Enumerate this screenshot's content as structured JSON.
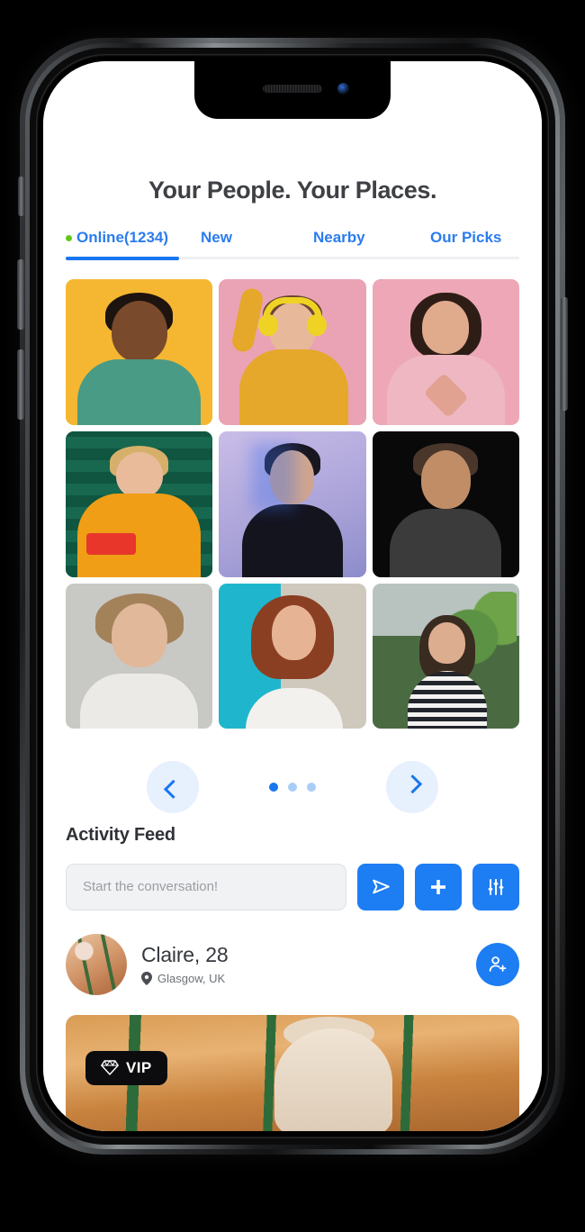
{
  "app": {
    "title": "Your People. Your Places."
  },
  "tabs": [
    {
      "label": "Online(1234)",
      "active": true,
      "has_online_dot": true
    },
    {
      "label": "New",
      "active": false,
      "has_online_dot": false
    },
    {
      "label": "Nearby",
      "active": false,
      "has_online_dot": false
    },
    {
      "label": "Our Picks",
      "active": false,
      "has_online_dot": false
    }
  ],
  "grid": {
    "people": [
      {
        "alt": "man-in-teal-polo-yellow-background"
      },
      {
        "alt": "woman-with-yellow-headphones-pink-background"
      },
      {
        "alt": "woman-making-heart-hands-pink-background"
      },
      {
        "alt": "woman-in-orange-holding-red-phone-green-background"
      },
      {
        "alt": "woman-blue-lit-lavender-background"
      },
      {
        "alt": "man-dark-background"
      },
      {
        "alt": "blond-man-gray-background"
      },
      {
        "alt": "red-haired-woman-turquoise-background"
      },
      {
        "alt": "smiling-woman-greenhouse-background"
      }
    ]
  },
  "carousel": {
    "prev_label": "Previous",
    "next_label": "Next",
    "total_dots": 3,
    "active_dot": 1
  },
  "feed": {
    "heading": "Activity Feed",
    "compose_placeholder": "Start the conversation!",
    "compose_value": "",
    "actions": [
      {
        "name": "send-button",
        "icon": "send-icon"
      },
      {
        "name": "add-button",
        "icon": "plus-icon"
      },
      {
        "name": "filter-button",
        "icon": "sliders-icon"
      }
    ],
    "person": {
      "name": "Claire, 28",
      "location": "Glasgow, UK",
      "add_label": "Add friend"
    },
    "post": {
      "badge": "VIP",
      "badge_icon": "diamond-icon"
    }
  },
  "colors": {
    "accent": "#1876ef",
    "accent_button": "#1d7df3",
    "tab_link": "#2b7cf0",
    "online_dot": "#63c71c",
    "title_text": "#3e4045",
    "badge_bg": "#0c0c0e"
  }
}
